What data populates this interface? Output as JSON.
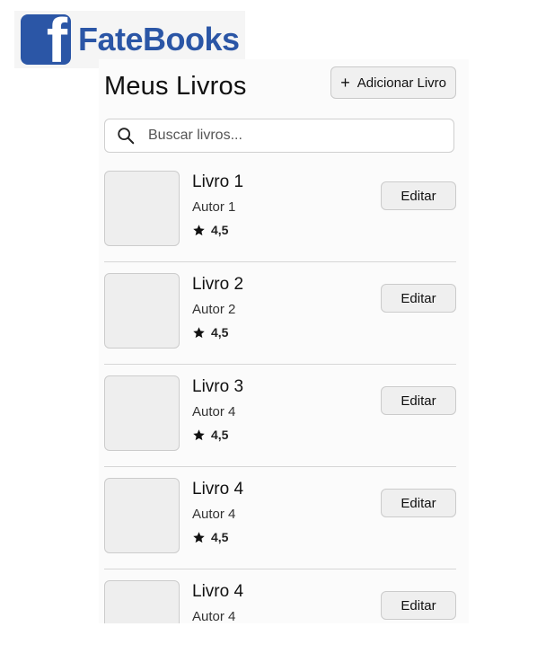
{
  "brand": {
    "logo_letter": "f",
    "name": "FateBooks",
    "color": "#2b56a6"
  },
  "header": {
    "title": "Meus Livros",
    "add_button": {
      "icon": "+",
      "label": "Adicionar Livro"
    }
  },
  "search": {
    "icon": "search-icon",
    "placeholder": "Buscar livros...",
    "value": ""
  },
  "books": [
    {
      "title": "Livro 1",
      "author": "Autor 1",
      "rating": "4,5",
      "edit_label": "Editar"
    },
    {
      "title": "Livro 2",
      "author": "Autor 2",
      "rating": "4,5",
      "edit_label": "Editar"
    },
    {
      "title": "Livro 3",
      "author": "Autor 4",
      "rating": "4,5",
      "edit_label": "Editar"
    },
    {
      "title": "Livro 4",
      "author": "Autor 4",
      "rating": "4,5",
      "edit_label": "Editar"
    },
    {
      "title": "Livro 4",
      "author": "Autor 4",
      "rating": null,
      "edit_label": "Editar"
    }
  ]
}
